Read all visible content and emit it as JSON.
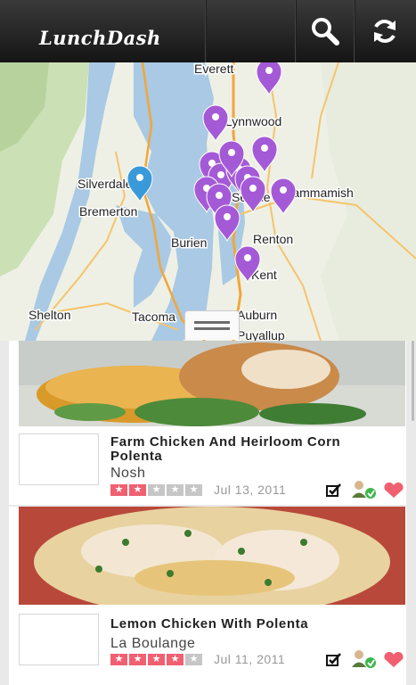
{
  "app": {
    "title": "LunchDash"
  },
  "toolbar": {
    "search_icon": "search-icon",
    "refresh_icon": "refresh-icon"
  },
  "map": {
    "labels": [
      "Everett",
      "Lynnwood",
      "Silverdale",
      "Sammamish",
      "Bremerton",
      "Seattle",
      "Burien",
      "Renton",
      "Kent",
      "Shelton",
      "Tacoma",
      "Auburn",
      "Puyallup"
    ]
  },
  "feed": [
    {
      "title": "Farm Chicken And Heirloom Corn Polenta",
      "restaurant": "Nosh",
      "rating": 2,
      "rating_max": 5,
      "date": "Jul 13, 2011"
    },
    {
      "title": "Lemon Chicken With Polenta",
      "restaurant": "La Boulange",
      "rating": 4,
      "rating_max": 5,
      "date": "Jul 11, 2011"
    }
  ],
  "colors": {
    "accent": "#f06070",
    "pin_purple": "#a45ad6",
    "pin_blue": "#3a9ad9",
    "topbar": "#1f1f1f"
  }
}
